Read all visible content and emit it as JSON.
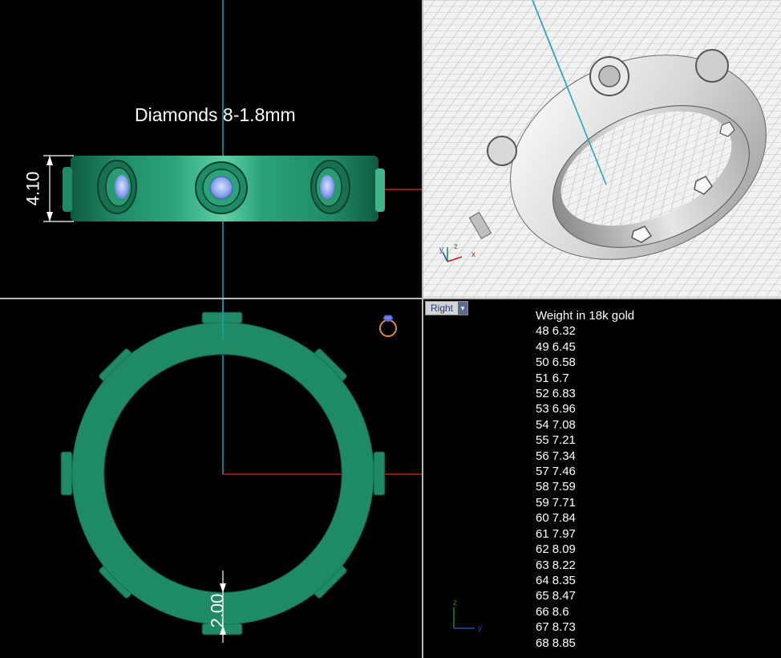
{
  "front_view": {
    "annotation": "Diamonds 8-1.8mm",
    "height_dimension": "4.10"
  },
  "top_view": {
    "width_dimension": "2.00"
  },
  "right_view": {
    "label": "Right",
    "dropdown_glyph": "▾",
    "weight_title": "Weight in 18k gold",
    "weights": [
      {
        "size": "48",
        "weight": "6.32"
      },
      {
        "size": "49",
        "weight": "6.45"
      },
      {
        "size": "50",
        "weight": "6.58"
      },
      {
        "size": "51",
        "weight": "6.7"
      },
      {
        "size": "52",
        "weight": "6.83"
      },
      {
        "size": "53",
        "weight": "6.96"
      },
      {
        "size": "54",
        "weight": "7.08"
      },
      {
        "size": "55",
        "weight": "7.21"
      },
      {
        "size": "56",
        "weight": "7.34"
      },
      {
        "size": "57",
        "weight": "7.46"
      },
      {
        "size": "58",
        "weight": "7.59"
      },
      {
        "size": "59",
        "weight": "7.71"
      },
      {
        "size": "60",
        "weight": "7.84"
      },
      {
        "size": "61",
        "weight": "7.97"
      },
      {
        "size": "62",
        "weight": "8.09"
      },
      {
        "size": "63",
        "weight": "8.22"
      },
      {
        "size": "64",
        "weight": "8.35"
      },
      {
        "size": "65",
        "weight": "8.47"
      },
      {
        "size": "66",
        "weight": "8.6"
      },
      {
        "size": "67",
        "weight": "8.73"
      },
      {
        "size": "68",
        "weight": "8.85"
      }
    ],
    "axis_z": "z",
    "axis_y": "y"
  },
  "perspective_view": {
    "axis_y": "y",
    "axis_z": "z",
    "axis_x": "x"
  },
  "colors": {
    "ring_green": "#1f8a66",
    "ring_green_light": "#3fb58a",
    "diamond_blue": "#8fa8f0",
    "axis_red": "#c81e1e",
    "axis_cyan": "#1aa3b8",
    "grid_dark": "#3a3a3a",
    "persp_bg": "#f2f2f2"
  },
  "icons": [
    "ring-icon",
    "axis-gizmo-icon",
    "dropdown-arrow-icon"
  ]
}
